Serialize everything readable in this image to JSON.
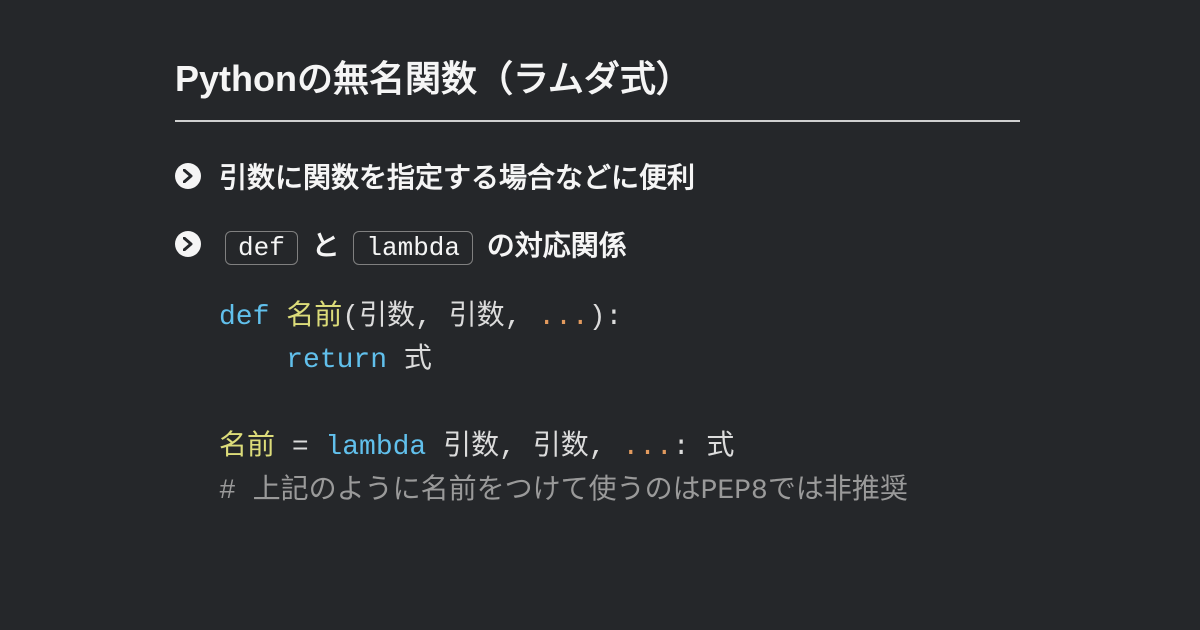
{
  "title": "Pythonの無名関数（ラムダ式）",
  "bullets": [
    {
      "text": "引数に関数を指定する場合などに便利"
    },
    {
      "prefix_code": "def",
      "mid_text": "と",
      "mid_code": "lambda",
      "suffix_text": "の対応関係"
    }
  ],
  "code": {
    "line1": {
      "kw": "def",
      "name": " 名前",
      "open": "(",
      "p1": "引数",
      "c1": ", ",
      "p2": "引数",
      "c2": ", ",
      "dots": "...",
      "close": "):"
    },
    "line2": {
      "indent": "    ",
      "kw": "return",
      "expr": " 式"
    },
    "line3": {
      "name": "名前 ",
      "eq": "= ",
      "kw": "lambda",
      "sp": " ",
      "p1": "引数",
      "c1": ", ",
      "p2": "引数",
      "c2": ", ",
      "dots": "...",
      "colon": ": ",
      "expr": "式"
    },
    "line4": {
      "comment": "# 上記のように名前をつけて使うのはPEP8では非推奨"
    }
  }
}
